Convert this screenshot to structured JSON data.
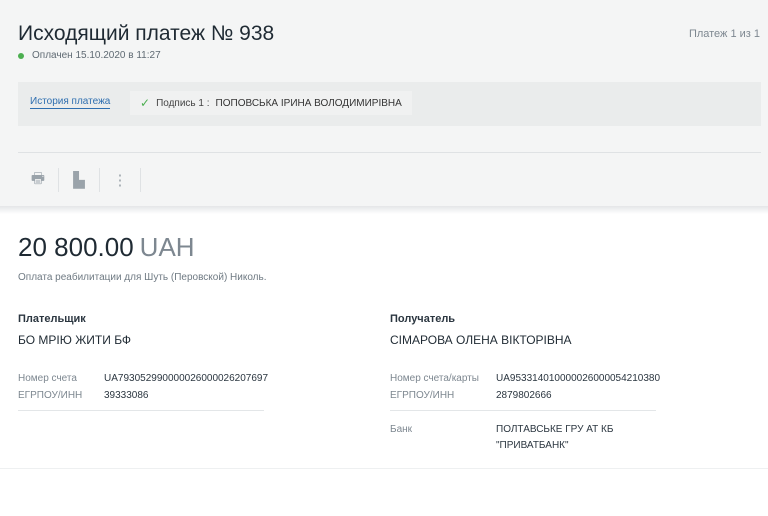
{
  "header": {
    "title": "Исходящий платеж № 938",
    "counter": "Платеж 1 из 1",
    "status": "Оплачен 15.10.2020 в 11:27"
  },
  "info": {
    "history_link": "История платежа",
    "sign_label": "Подпись 1 :",
    "signer": "ПОПОВСЬКА ІРИНА ВОЛОДИМИРІВНА"
  },
  "toolbar": {
    "print_icon": "🖶",
    "copy_icon": "▙",
    "more_icon": "⋮"
  },
  "payment": {
    "amount": "20 800.00",
    "currency": "UAH",
    "purpose": "Оплата реабилитации для Шуть (Перовской) Николь."
  },
  "payer": {
    "heading": "Плательщик",
    "name": "БО МРІЮ ЖИТИ БФ",
    "account_label": "Номер счета",
    "account": "UA793052990000026000026207697",
    "edrpou_label": "ЕГРПОУ/ИНН",
    "edrpou": "39333086"
  },
  "receiver": {
    "heading": "Получатель",
    "name": "СІМАРОВА ОЛЕНА ВІКТОРІВНА",
    "account_label": "Номер счета/карты",
    "account": "UA953314010000026000054210380",
    "edrpou_label": "ЕГРПОУ/ИНН",
    "edrpou": "2879802666",
    "bank_label": "Банк",
    "bank_line1": "ПОЛТАВСЬКЕ ГРУ АТ КБ",
    "bank_line2": "\"ПРИВАТБАНК\""
  },
  "colors": {
    "status_dot": "#4caf50",
    "link": "#2f6fb0",
    "check": "#4caf50"
  }
}
